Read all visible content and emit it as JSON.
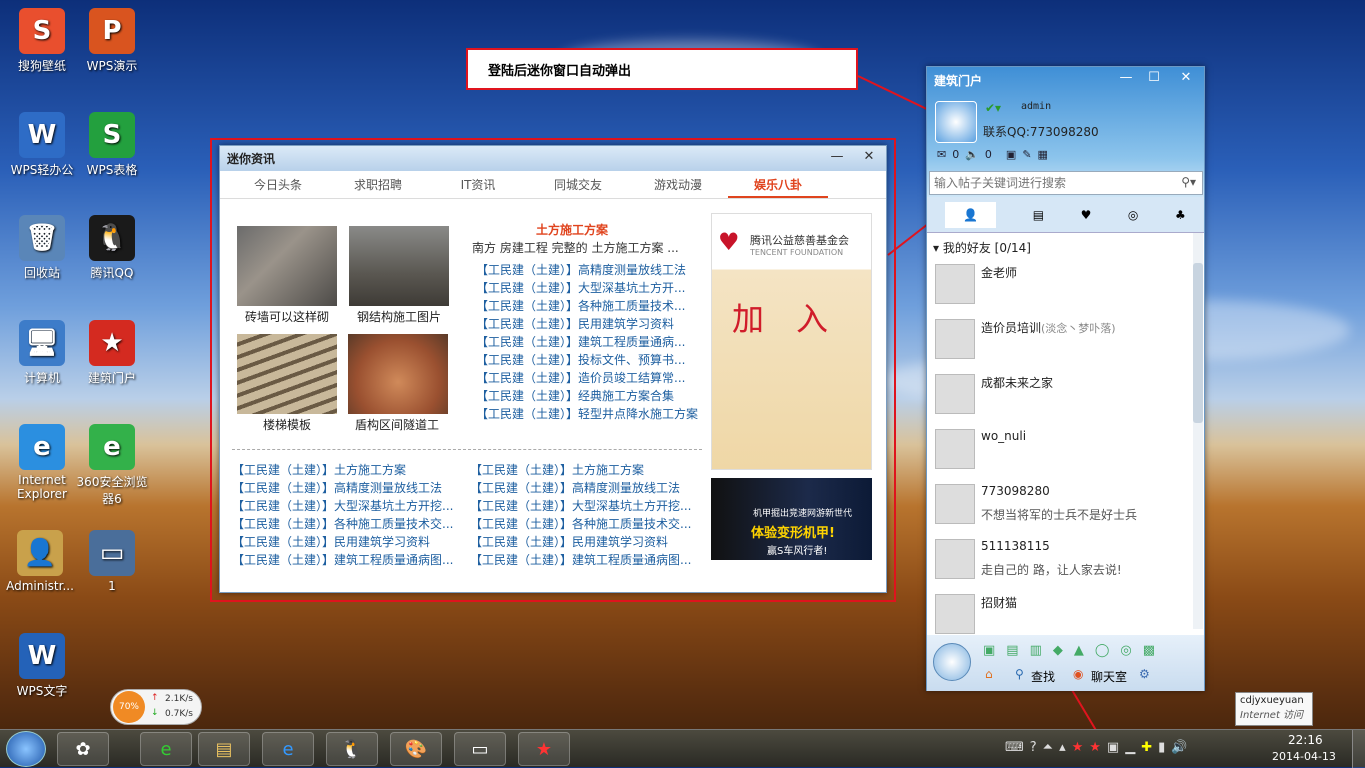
{
  "desktop_icons": [
    {
      "label": "搜狗壁纸",
      "glyph": "S",
      "color": "#e94f2e"
    },
    {
      "label": "WPS演示",
      "glyph": "P",
      "color": "#d9541f"
    },
    {
      "label": "WPS轻办公",
      "glyph": "W",
      "color": "#2e6cc6"
    },
    {
      "label": "WPS表格",
      "glyph": "S",
      "color": "#23a03e"
    },
    {
      "label": "回收站",
      "glyph": "🗑",
      "color": "#5a86b8"
    },
    {
      "label": "腾讯QQ",
      "glyph": "🐧",
      "color": "#1a1a1a"
    },
    {
      "label": "计算机",
      "glyph": "🖥",
      "color": "#3d7cc9"
    },
    {
      "label": "建筑门户",
      "glyph": "★",
      "color": "#d42a20"
    },
    {
      "label": "Internet Explorer",
      "glyph": "e",
      "color": "#2b8fe0"
    },
    {
      "label": "360安全浏览器6",
      "glyph": "e",
      "color": "#33b14a"
    },
    {
      "label": "Administr...",
      "glyph": "👤",
      "color": "#c9a14b"
    },
    {
      "label": "1",
      "glyph": "▭",
      "color": "#4a6e9a"
    },
    {
      "label": "WPS文字",
      "glyph": "W",
      "color": "#2462b8"
    }
  ],
  "annotation": {
    "text": "登陆后迷你窗口自动弹出"
  },
  "mini": {
    "title": "迷你资讯",
    "tabs": [
      "今日头条",
      "求职招聘",
      "IT资讯",
      "同城交友",
      "游戏动漫",
      "娱乐八卦"
    ],
    "captions": [
      "砖墙可以这样砌",
      "钢结构施工图片",
      "楼梯模板",
      "盾构区间隧道工"
    ],
    "headline": "土方施工方案",
    "headline_sub": "南方 房建工程 完整的 土方施工方案 ...",
    "right_list": [
      "【工民建（土建）】高精度测量放线工法",
      "【工民建（土建）】大型深基坑土方开...",
      "【工民建（土建）】各种施工质量技术...",
      "【工民建（土建）】民用建筑学习资料",
      "【工民建（土建）】建筑工程质量通病...",
      "【工民建（土建）】投标文件、预算书...",
      "【工民建（土建）】造价员竣工结算常...",
      "【工民建（土建）】经典施工方案合集",
      "【工民建（土建）】轻型井点降水施工方案"
    ],
    "bottom_left": [
      "【工民建（土建）】土方施工方案",
      "【工民建（土建）】高精度测量放线工法",
      "【工民建（土建）】大型深基坑土方开挖...",
      "【工民建（土建）】各种施工质量技术交...",
      "【工民建（土建）】民用建筑学习资料",
      "【工民建（土建）】建筑工程质量通病图..."
    ],
    "bottom_right": [
      "【工民建（土建）】土方施工方案",
      "【工民建（土建）】高精度测量放线工法",
      "【工民建（土建）】大型深基坑土方开挖...",
      "【工民建（土建）】各种施工质量技术交...",
      "【工民建（土建）】民用建筑学习资料",
      "【工民建（土建）】建筑工程质量通病图..."
    ],
    "ad1_title": "腾讯公益慈善基金会",
    "ad1_sub": "TENCENT FOUNDATION",
    "ad1_big": "加　入",
    "ad2_line1": "机甲掘出竞速网游新世代",
    "ad2_line2": "体验变形机甲!",
    "ad2_line3": "赢S车风行者!"
  },
  "qq": {
    "title": "建筑门户",
    "user": "admin",
    "contact": "联系QQ:773098280",
    "mail_count": "0",
    "vol_count": "0",
    "search_placeholder": "输入帖子关键词进行搜索",
    "group": "我的好友 [0/14]",
    "friends": [
      {
        "name": "金老师",
        "sig": ""
      },
      {
        "name": "造价员培训",
        "extra": "(淡念丶梦卟落)",
        "sig": ""
      },
      {
        "name": "成都未来之家",
        "sig": ""
      },
      {
        "name": "wo_nuli",
        "sig": ""
      },
      {
        "name": "773098280",
        "sig": "不想当将军的士兵不是好士兵"
      },
      {
        "name": "511138115",
        "sig": "走自己的 路，让人家去说!"
      },
      {
        "name": "招财猫",
        "sig": ""
      }
    ],
    "find": "查找",
    "chat": "聊天室"
  },
  "speed": {
    "percent": "70%",
    "up": "2.1K/s",
    "down": "0.7K/s"
  },
  "tooltip": {
    "line1": "cdjyxueyuan",
    "line2": "Internet 访问"
  },
  "clock": {
    "time": "22:16",
    "date": "2014-04-13"
  }
}
